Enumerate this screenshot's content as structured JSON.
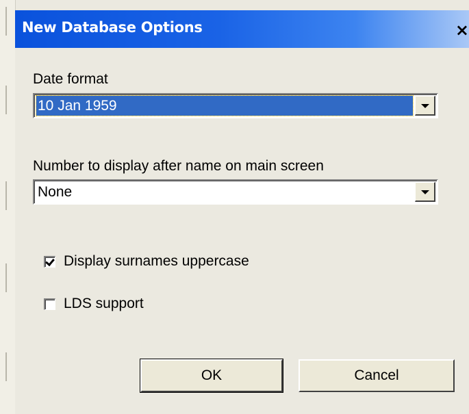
{
  "window": {
    "title": "New Database Options",
    "close_label": "×"
  },
  "date_format": {
    "label": "Date format",
    "selected_value": "10 Jan 1959"
  },
  "number_display": {
    "label": "Number to display after name on main screen",
    "selected_value": "None"
  },
  "checkboxes": [
    {
      "label": "Display surnames uppercase",
      "checked": true
    },
    {
      "label": "LDS support",
      "checked": false
    }
  ],
  "buttons": {
    "ok_label": "OK",
    "cancel_label": "Cancel"
  },
  "colors": {
    "title_bar": "#0a52dc",
    "selection": "#316ac5",
    "dialog_bg": "#ebe9e0"
  }
}
